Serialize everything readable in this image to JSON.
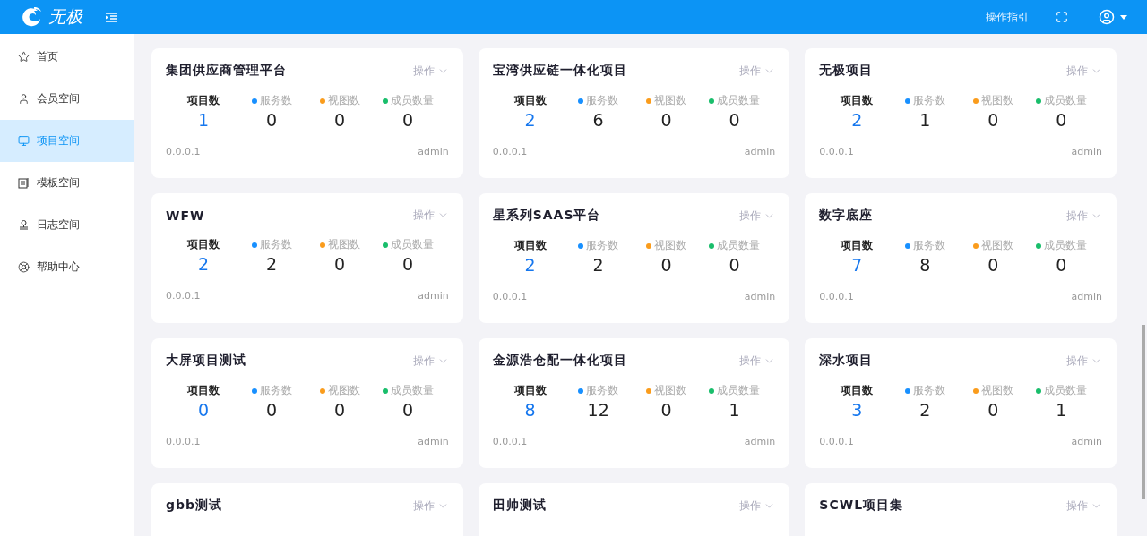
{
  "header": {
    "logo_text": "无极",
    "guide_link": "操作指引"
  },
  "sidebar": {
    "items": [
      {
        "label": "首页",
        "selected": false
      },
      {
        "label": "会员空间",
        "selected": false
      },
      {
        "label": "项目空间",
        "selected": true
      },
      {
        "label": "模板空间",
        "selected": false
      },
      {
        "label": "日志空间",
        "selected": false
      },
      {
        "label": "帮助中心",
        "selected": false
      }
    ]
  },
  "projects": [
    {
      "title": "集团供应商管理平台",
      "action": "操作",
      "stats": [
        {
          "label": "项目数",
          "value": "1"
        },
        {
          "label": "服务数",
          "value": "0",
          "color": "#1890ff"
        },
        {
          "label": "视图数",
          "value": "0",
          "color": "#fa9c1c"
        },
        {
          "label": "成员数量",
          "value": "0",
          "color": "#19be6b"
        }
      ],
      "version": "0.0.0.1",
      "owner": "admin"
    },
    {
      "title": "宝湾供应链一体化项目",
      "action": "操作",
      "stats": [
        {
          "label": "项目数",
          "value": "2"
        },
        {
          "label": "服务数",
          "value": "6",
          "color": "#1890ff"
        },
        {
          "label": "视图数",
          "value": "0",
          "color": "#fa9c1c"
        },
        {
          "label": "成员数量",
          "value": "0",
          "color": "#19be6b"
        }
      ],
      "version": "0.0.0.1",
      "owner": "admin"
    },
    {
      "title": "无极项目",
      "action": "操作",
      "stats": [
        {
          "label": "项目数",
          "value": "2"
        },
        {
          "label": "服务数",
          "value": "1",
          "color": "#1890ff"
        },
        {
          "label": "视图数",
          "value": "0",
          "color": "#fa9c1c"
        },
        {
          "label": "成员数量",
          "value": "0",
          "color": "#19be6b"
        }
      ],
      "version": "0.0.0.1",
      "owner": "admin"
    },
    {
      "title": "WFW",
      "action": "操作",
      "stats": [
        {
          "label": "项目数",
          "value": "2"
        },
        {
          "label": "服务数",
          "value": "2",
          "color": "#1890ff"
        },
        {
          "label": "视图数",
          "value": "0",
          "color": "#fa9c1c"
        },
        {
          "label": "成员数量",
          "value": "0",
          "color": "#19be6b"
        }
      ],
      "version": "0.0.0.1",
      "owner": "admin"
    },
    {
      "title": "星系列SAAS平台",
      "action": "操作",
      "stats": [
        {
          "label": "项目数",
          "value": "2"
        },
        {
          "label": "服务数",
          "value": "2",
          "color": "#1890ff"
        },
        {
          "label": "视图数",
          "value": "0",
          "color": "#fa9c1c"
        },
        {
          "label": "成员数量",
          "value": "0",
          "color": "#19be6b"
        }
      ],
      "version": "0.0.0.1",
      "owner": "admin"
    },
    {
      "title": "数字底座",
      "action": "操作",
      "stats": [
        {
          "label": "项目数",
          "value": "7"
        },
        {
          "label": "服务数",
          "value": "8",
          "color": "#1890ff"
        },
        {
          "label": "视图数",
          "value": "0",
          "color": "#fa9c1c"
        },
        {
          "label": "成员数量",
          "value": "0",
          "color": "#19be6b"
        }
      ],
      "version": "0.0.0.1",
      "owner": "admin"
    },
    {
      "title": "大屏项目测试",
      "action": "操作",
      "stats": [
        {
          "label": "项目数",
          "value": "0"
        },
        {
          "label": "服务数",
          "value": "0",
          "color": "#1890ff"
        },
        {
          "label": "视图数",
          "value": "0",
          "color": "#fa9c1c"
        },
        {
          "label": "成员数量",
          "value": "0",
          "color": "#19be6b"
        }
      ],
      "version": "0.0.0.1",
      "owner": "admin"
    },
    {
      "title": "金源浩仓配一体化项目",
      "action": "操作",
      "stats": [
        {
          "label": "项目数",
          "value": "8"
        },
        {
          "label": "服务数",
          "value": "12",
          "color": "#1890ff"
        },
        {
          "label": "视图数",
          "value": "0",
          "color": "#fa9c1c"
        },
        {
          "label": "成员数量",
          "value": "1",
          "color": "#19be6b"
        }
      ],
      "version": "0.0.0.1",
      "owner": "admin"
    },
    {
      "title": "深水项目",
      "action": "操作",
      "stats": [
        {
          "label": "项目数",
          "value": "3"
        },
        {
          "label": "服务数",
          "value": "2",
          "color": "#1890ff"
        },
        {
          "label": "视图数",
          "value": "0",
          "color": "#fa9c1c"
        },
        {
          "label": "成员数量",
          "value": "1",
          "color": "#19be6b"
        }
      ],
      "version": "0.0.0.1",
      "owner": "admin"
    },
    {
      "title": "gbb测试",
      "action": "操作"
    },
    {
      "title": "田帅测试",
      "action": "操作"
    },
    {
      "title": "SCWL项目集",
      "action": "操作"
    }
  ]
}
